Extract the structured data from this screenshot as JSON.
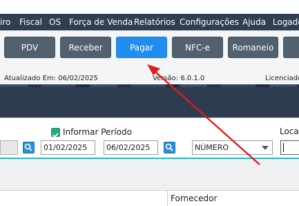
{
  "menu": {
    "items": [
      "iro",
      "Fiscal",
      "OS",
      "Força de Venda",
      "Relatórios",
      "Configurações",
      "Ajuda",
      "Logado"
    ]
  },
  "toolbar": {
    "buttons": [
      {
        "label": "PDV",
        "active": false
      },
      {
        "label": "Receber",
        "active": false
      },
      {
        "label": "Pagar",
        "active": true
      },
      {
        "label": "NFC-e",
        "active": false
      },
      {
        "label": "Romaneio",
        "active": false
      }
    ]
  },
  "info": {
    "updated": "Atualizado Em: 06/02/2025",
    "version": "Versão: 6.0.1.0",
    "license": "Licenciado"
  },
  "filters": {
    "period_checkbox_label": "Informar Período",
    "period_checked": true,
    "date_from": "01/02/2025",
    "date_to": "06/02/2025",
    "search_type": "NÚMERO",
    "locate_label": "Loca"
  },
  "grid": {
    "columns": [
      "Fornecedor"
    ]
  },
  "colors": {
    "menubar": "#2f3f52",
    "button": "#51616f",
    "button_active": "#1f8ef0",
    "annotation_arrow": "#e01b1b",
    "accent_line": "#2ab3c6"
  },
  "icons": {
    "search": "magnifier-icon",
    "checkbox": "check-icon",
    "dropdown": "chevron-down-icon"
  }
}
